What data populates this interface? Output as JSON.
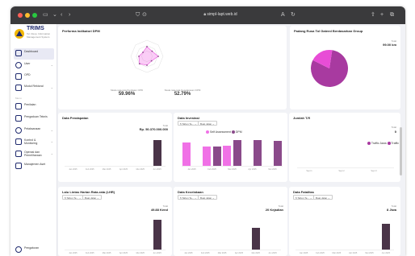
{
  "browser": {
    "url": "simpl-lapt.web.id",
    "reader_label": "A",
    "icons": [
      "sidebar-toggle-icon",
      "back-icon",
      "forward-icon",
      "shield-icon",
      "lock-icon",
      "translate-icon",
      "reload-icon",
      "share-icon",
      "new-tab-icon",
      "tabs-icon"
    ]
  },
  "app": {
    "name": "TRIMS",
    "subtitle": "Tel. Resp. Information Management System"
  },
  "sidebar": {
    "items": [
      {
        "label": "Dashboard",
        "icon": "dashboard-icon",
        "active": true
      },
      {
        "label": "User",
        "icon": "user-icon",
        "chevron": true
      },
      {
        "label": "OPD",
        "icon": "building-icon"
      },
      {
        "label": "Modul Rektoral",
        "icon": "database-icon",
        "chevron": true
      },
      {
        "label": "Penilaian",
        "icon": "form-icon"
      },
      {
        "label": "Pengaduan Teknis",
        "icon": "document-icon"
      },
      {
        "label": "Pelaksanaan",
        "icon": "gear-icon",
        "chevron": true
      },
      {
        "label": "Kontrol & Monitoring",
        "icon": "monitor-icon",
        "chevron": true
      },
      {
        "label": "Operasi dan Pemeliharaan",
        "icon": "tools-icon",
        "chevron": true
      },
      {
        "label": "Manajemen Aset",
        "icon": "asset-icon"
      }
    ],
    "section_label": "Menu",
    "footer_label": "Pengaturan"
  },
  "cards": {
    "performa": {
      "title": "Performa Indikatori DPM",
      "left_caption": "Skala rata-rata Penilaian OPD",
      "left_value": "59.96%",
      "right_caption": "Skala rata-rata Keselarasan DPM",
      "right_value": "52.79%"
    },
    "padang": {
      "title": "Padang Rusa Tol Gateed Berdasarkan Group",
      "total_label": "Total",
      "total_value": "99.00 km"
    },
    "pendapatan": {
      "title": "Data Pendapatan",
      "total_label": "Total",
      "total_value": "Rp. 50.370.000.000",
      "x_labels": [
        "Jan 2025",
        "Feb 2025",
        "Mar 2025",
        "Apr 2025",
        "Mei 2025",
        "Jun 2025"
      ]
    },
    "investasi": {
      "title": "Data Investasi",
      "filter_year": "5 Tahun Te...",
      "filter_month": "Buat Jalan",
      "legend": [
        "Self Assessment",
        "DPM"
      ],
      "x_labels": [
        "Jan 2025",
        "Feb 2025",
        "Mar 2025",
        "Apr 2025",
        "Mei 2025"
      ]
    },
    "jumlah": {
      "title": "Jumlah T.R",
      "total_label": "Total",
      "total_value": "0",
      "legend": [
        "Traffic Jawa",
        "Traffic"
      ],
      "x_labels": [
        "Sept 1",
        "Sept 2",
        "Sept 3"
      ]
    },
    "lalin": {
      "title": "Lalu Lintas Harian Rata-rata (LHR)",
      "filter_year": "5 Tahun Te...",
      "filter_month": "Buat Jalan",
      "total_label": "Total",
      "total_value": "49.88 Kend",
      "x_labels": [
        "Jan 2025",
        "Feb 2025",
        "Mar 2025",
        "Apr 2025",
        "Mei 2025",
        "Jun 2025"
      ]
    },
    "kecelakaan": {
      "title": "Data Kecelakaan",
      "filter_year": "5 Tahun Te...",
      "filter_month": "Buat Jalan",
      "total_label": "Total",
      "total_value": "20 Kejadian",
      "x_labels": [
        "Jan 2025",
        "Feb 2025",
        "Mar 2025",
        "Apr 2025",
        "Mei 2025",
        "Jun 2025"
      ]
    },
    "fatalitas": {
      "title": "Data Fatalitas",
      "filter_year": "5 Tahun Te...",
      "filter_month": "Buat Jalan",
      "total_label": "Total",
      "total_value": "8 Jiwa",
      "x_labels": [
        "Jan 2025",
        "Feb 2025",
        "Mar 2025",
        "Apr 2025",
        "Mei 2025",
        "Jun 2025"
      ]
    }
  },
  "colors": {
    "bar_dark": "#4a3448",
    "pink": "#f071e6",
    "purple": "#8a4a8a",
    "pie_main": "#a83aa0",
    "pie_slice": "#e84dd6"
  },
  "chart_data": [
    {
      "type": "bar",
      "id": "pendapatan",
      "categories": [
        "Jan 2025",
        "Feb 2025",
        "Mar 2025",
        "Apr 2025",
        "Mei 2025",
        "Jun 2025"
      ],
      "values": [
        0,
        0,
        0,
        0,
        0,
        50.37
      ],
      "ylim": [
        0,
        60
      ]
    },
    {
      "type": "bar",
      "id": "investasi",
      "categories": [
        "Jan 2025",
        "Feb 2025",
        "Mar 2025",
        "Apr 2025",
        "Mei 2025"
      ],
      "series": [
        {
          "name": "Self Assessment",
          "values": [
            85,
            70,
            75,
            0,
            0
          ]
        },
        {
          "name": "DPM",
          "values": [
            0,
            70,
            95,
            95,
            90
          ]
        }
      ],
      "ylim": [
        0,
        100
      ]
    },
    {
      "type": "line",
      "id": "jumlah",
      "categories": [
        "Sept 1",
        "Sept 2",
        "Sept 3"
      ],
      "series": [
        {
          "name": "Traffic Jawa",
          "values": [
            0,
            0,
            0
          ]
        },
        {
          "name": "Traffic",
          "values": [
            0,
            0,
            0
          ]
        }
      ]
    },
    {
      "type": "bar",
      "id": "lalin",
      "categories": [
        "Jan 2025",
        "Feb 2025",
        "Mar 2025",
        "Apr 2025",
        "Mei 2025",
        "Jun 2025"
      ],
      "values": [
        0,
        0,
        0,
        0,
        0,
        49.88
      ],
      "ylim": [
        0,
        60
      ]
    },
    {
      "type": "bar",
      "id": "kecelakaan",
      "categories": [
        "Jan 2025",
        "Feb 2025",
        "Mar 2025",
        "Apr 2025",
        "Mei 2025",
        "Jun 2025"
      ],
      "values": [
        0,
        0,
        0,
        0,
        20,
        0
      ],
      "ylim": [
        0,
        25
      ]
    },
    {
      "type": "bar",
      "id": "fatalitas",
      "categories": [
        "Jan 2025",
        "Feb 2025",
        "Mar 2025",
        "Apr 2025",
        "Mei 2025",
        "Jun 2025"
      ],
      "values": [
        0,
        0,
        0,
        0,
        0,
        8
      ],
      "ylim": [
        0,
        10
      ]
    },
    {
      "type": "pie",
      "id": "padang",
      "values": [
        80,
        20
      ]
    },
    {
      "type": "radar",
      "id": "performa",
      "values": [
        60,
        45,
        70,
        40,
        55,
        65,
        50,
        35
      ]
    }
  ]
}
